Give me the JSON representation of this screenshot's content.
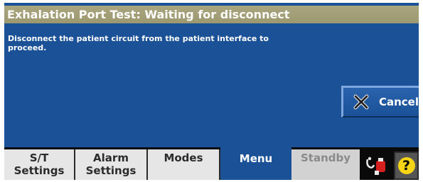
{
  "title": "Exhalation Port Test:  Waiting for disconnect",
  "message": {
    "line1": "Disconnect the patient circuit from the patient interface to",
    "line2": "proceed."
  },
  "cancel_button": {
    "label": "Cancel",
    "icon": "x-icon"
  },
  "tabs": [
    {
      "line1": "S/T",
      "line2": "Settings",
      "state": "normal"
    },
    {
      "line1": "Alarm",
      "line2": "Settings",
      "state": "normal"
    },
    {
      "line1": "Modes",
      "line2": "",
      "state": "normal"
    },
    {
      "line1": "Menu",
      "line2": "",
      "state": "active"
    },
    {
      "line1": "Standby",
      "line2": "",
      "state": "disabled"
    }
  ],
  "status_icons": {
    "mask": "patient-mask-icon",
    "help": {
      "icon": "help-icon",
      "glyph": "?"
    }
  },
  "colors": {
    "background": "#1a5197",
    "title_bar": "#a9a57e",
    "help_yellow": "#f5d416"
  }
}
